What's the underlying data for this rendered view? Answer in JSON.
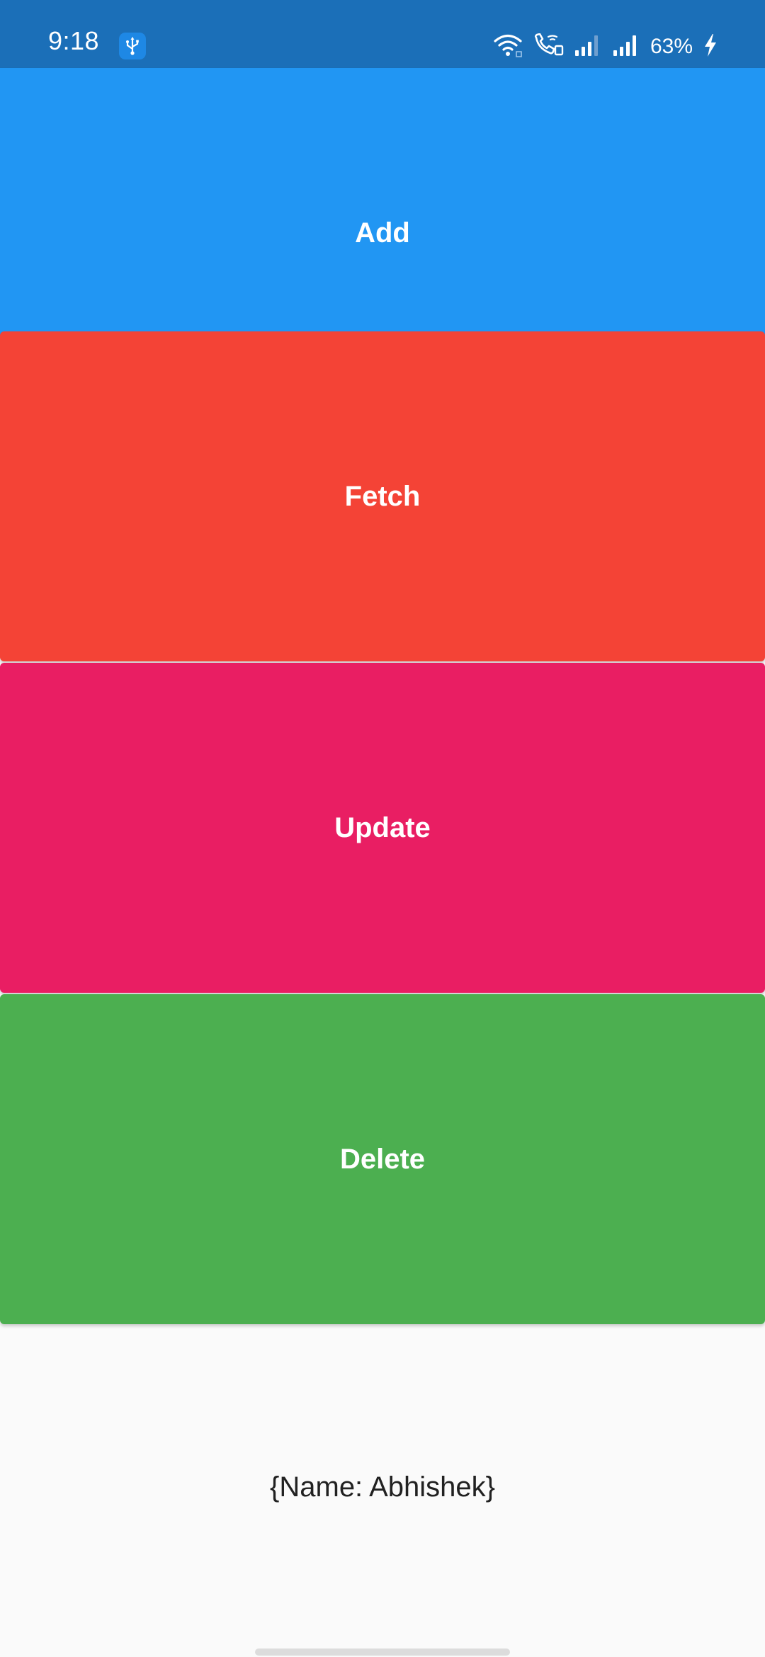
{
  "status_bar": {
    "time": "9:18",
    "battery": "63%",
    "background": "#1b6fb8",
    "icons": [
      "usb-icon",
      "wifi-icon",
      "wifi-calling-icon",
      "signal-icon",
      "signal-icon",
      "charging-icon"
    ]
  },
  "buttons": {
    "add": {
      "label": "Add",
      "color": "#2196f3"
    },
    "fetch": {
      "label": "Fetch",
      "color": "#f44336"
    },
    "update": {
      "label": "Update",
      "color": "#e91e63"
    },
    "delete": {
      "label": "Delete",
      "color": "#4caf50"
    }
  },
  "result": {
    "text": "{Name: Abhishek}"
  }
}
